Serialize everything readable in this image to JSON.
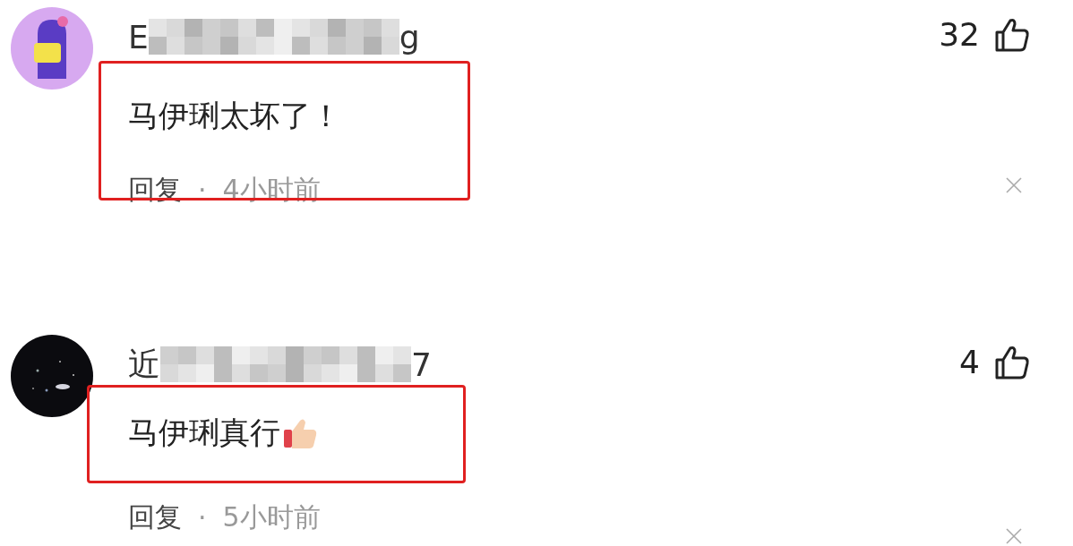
{
  "comments": [
    {
      "avatar": {
        "kind": "cartoon"
      },
      "name_start": "E",
      "name_obscured": true,
      "name_end": "g",
      "likes": "32",
      "text": "马伊琍太坏了！",
      "highlighted": true,
      "reply": "回复",
      "separator": "·",
      "time": "4小时前"
    },
    {
      "name_start": "近",
      "name_obscured": true,
      "name_end": "7",
      "likes": "4",
      "text": "马伊琍真行",
      "emoji": {
        "kind": "thumbs-up"
      },
      "highlighted": true,
      "reply": "回复",
      "separator": "·",
      "time": "5小时前"
    }
  ]
}
